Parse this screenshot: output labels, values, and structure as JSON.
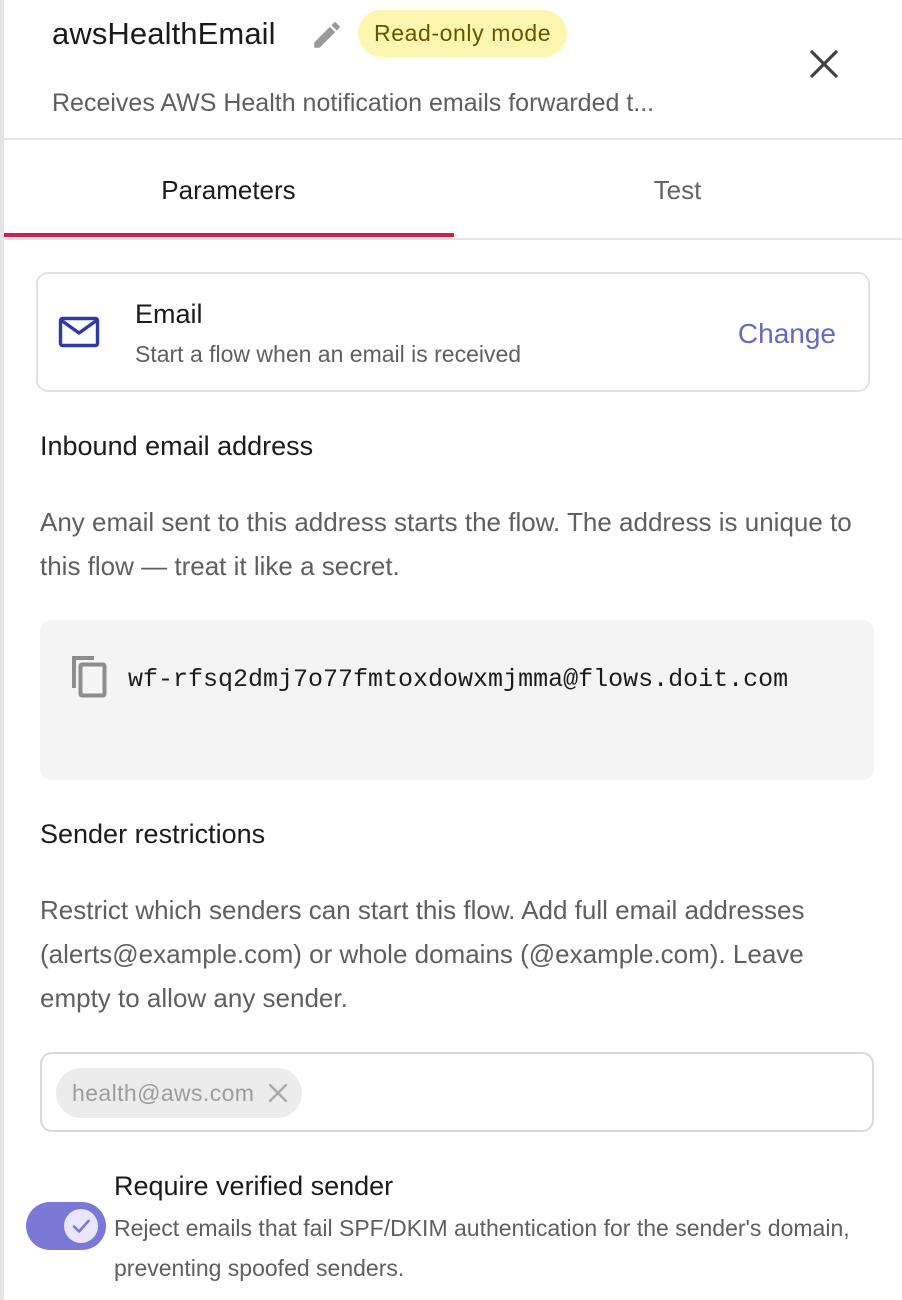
{
  "header": {
    "title": "awsHealthEmail",
    "edit_icon": "pencil-icon",
    "badge": "Read-only mode",
    "subtitle": "Receives AWS Health notification emails forwarded t...",
    "close_icon": "close-icon"
  },
  "tabs": [
    {
      "label": "Parameters",
      "active": true
    },
    {
      "label": "Test",
      "active": false
    }
  ],
  "trigger": {
    "icon": "mail-icon",
    "title": "Email",
    "description": "Start a flow when an email is received",
    "action_label": "Change"
  },
  "inbound": {
    "heading": "Inbound email address",
    "description": "Any email sent to this address starts the flow. The address is unique to this flow — treat it like a secret.",
    "copy_icon": "copy-icon",
    "address": "wf-rfsq2dmj7o77fmtoxdowxmjmma@flows.doit.com"
  },
  "sender_restrictions": {
    "heading": "Sender restrictions",
    "description": "Restrict which senders can start this flow. Add full email addresses (alerts@example.com) or whole domains (@example.com). Leave empty to allow any sender.",
    "chips": [
      "health@aws.com"
    ]
  },
  "verified_sender": {
    "title": "Require verified sender",
    "description": "Reject emails that fail SPF/DKIM authentication for the sender's domain, preventing spoofed senders.",
    "enabled": true
  },
  "colors": {
    "accent_tab": "#d31d4b",
    "link": "#6369c4",
    "toggle_on": "#7c78d6",
    "badge_bg": "#fbf6b0",
    "badge_text": "#6a5300",
    "mail_icon": "#2e3aa6"
  }
}
